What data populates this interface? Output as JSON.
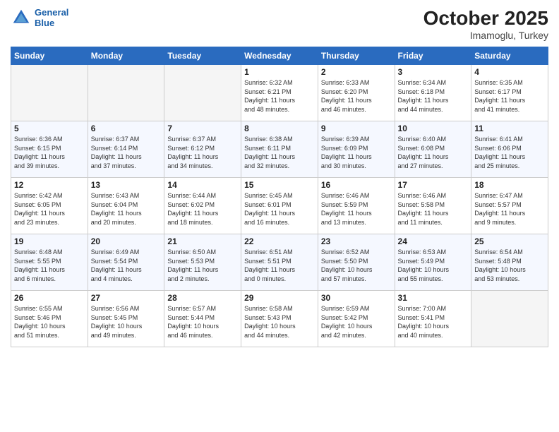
{
  "header": {
    "logo_line1": "General",
    "logo_line2": "Blue",
    "month": "October 2025",
    "location": "Imamoglu, Turkey"
  },
  "days_of_week": [
    "Sunday",
    "Monday",
    "Tuesday",
    "Wednesday",
    "Thursday",
    "Friday",
    "Saturday"
  ],
  "weeks": [
    [
      {
        "day": "",
        "info": ""
      },
      {
        "day": "",
        "info": ""
      },
      {
        "day": "",
        "info": ""
      },
      {
        "day": "1",
        "info": "Sunrise: 6:32 AM\nSunset: 6:21 PM\nDaylight: 11 hours\nand 48 minutes."
      },
      {
        "day": "2",
        "info": "Sunrise: 6:33 AM\nSunset: 6:20 PM\nDaylight: 11 hours\nand 46 minutes."
      },
      {
        "day": "3",
        "info": "Sunrise: 6:34 AM\nSunset: 6:18 PM\nDaylight: 11 hours\nand 44 minutes."
      },
      {
        "day": "4",
        "info": "Sunrise: 6:35 AM\nSunset: 6:17 PM\nDaylight: 11 hours\nand 41 minutes."
      }
    ],
    [
      {
        "day": "5",
        "info": "Sunrise: 6:36 AM\nSunset: 6:15 PM\nDaylight: 11 hours\nand 39 minutes."
      },
      {
        "day": "6",
        "info": "Sunrise: 6:37 AM\nSunset: 6:14 PM\nDaylight: 11 hours\nand 37 minutes."
      },
      {
        "day": "7",
        "info": "Sunrise: 6:37 AM\nSunset: 6:12 PM\nDaylight: 11 hours\nand 34 minutes."
      },
      {
        "day": "8",
        "info": "Sunrise: 6:38 AM\nSunset: 6:11 PM\nDaylight: 11 hours\nand 32 minutes."
      },
      {
        "day": "9",
        "info": "Sunrise: 6:39 AM\nSunset: 6:09 PM\nDaylight: 11 hours\nand 30 minutes."
      },
      {
        "day": "10",
        "info": "Sunrise: 6:40 AM\nSunset: 6:08 PM\nDaylight: 11 hours\nand 27 minutes."
      },
      {
        "day": "11",
        "info": "Sunrise: 6:41 AM\nSunset: 6:06 PM\nDaylight: 11 hours\nand 25 minutes."
      }
    ],
    [
      {
        "day": "12",
        "info": "Sunrise: 6:42 AM\nSunset: 6:05 PM\nDaylight: 11 hours\nand 23 minutes."
      },
      {
        "day": "13",
        "info": "Sunrise: 6:43 AM\nSunset: 6:04 PM\nDaylight: 11 hours\nand 20 minutes."
      },
      {
        "day": "14",
        "info": "Sunrise: 6:44 AM\nSunset: 6:02 PM\nDaylight: 11 hours\nand 18 minutes."
      },
      {
        "day": "15",
        "info": "Sunrise: 6:45 AM\nSunset: 6:01 PM\nDaylight: 11 hours\nand 16 minutes."
      },
      {
        "day": "16",
        "info": "Sunrise: 6:46 AM\nSunset: 5:59 PM\nDaylight: 11 hours\nand 13 minutes."
      },
      {
        "day": "17",
        "info": "Sunrise: 6:46 AM\nSunset: 5:58 PM\nDaylight: 11 hours\nand 11 minutes."
      },
      {
        "day": "18",
        "info": "Sunrise: 6:47 AM\nSunset: 5:57 PM\nDaylight: 11 hours\nand 9 minutes."
      }
    ],
    [
      {
        "day": "19",
        "info": "Sunrise: 6:48 AM\nSunset: 5:55 PM\nDaylight: 11 hours\nand 6 minutes."
      },
      {
        "day": "20",
        "info": "Sunrise: 6:49 AM\nSunset: 5:54 PM\nDaylight: 11 hours\nand 4 minutes."
      },
      {
        "day": "21",
        "info": "Sunrise: 6:50 AM\nSunset: 5:53 PM\nDaylight: 11 hours\nand 2 minutes."
      },
      {
        "day": "22",
        "info": "Sunrise: 6:51 AM\nSunset: 5:51 PM\nDaylight: 11 hours\nand 0 minutes."
      },
      {
        "day": "23",
        "info": "Sunrise: 6:52 AM\nSunset: 5:50 PM\nDaylight: 10 hours\nand 57 minutes."
      },
      {
        "day": "24",
        "info": "Sunrise: 6:53 AM\nSunset: 5:49 PM\nDaylight: 10 hours\nand 55 minutes."
      },
      {
        "day": "25",
        "info": "Sunrise: 6:54 AM\nSunset: 5:48 PM\nDaylight: 10 hours\nand 53 minutes."
      }
    ],
    [
      {
        "day": "26",
        "info": "Sunrise: 6:55 AM\nSunset: 5:46 PM\nDaylight: 10 hours\nand 51 minutes."
      },
      {
        "day": "27",
        "info": "Sunrise: 6:56 AM\nSunset: 5:45 PM\nDaylight: 10 hours\nand 49 minutes."
      },
      {
        "day": "28",
        "info": "Sunrise: 6:57 AM\nSunset: 5:44 PM\nDaylight: 10 hours\nand 46 minutes."
      },
      {
        "day": "29",
        "info": "Sunrise: 6:58 AM\nSunset: 5:43 PM\nDaylight: 10 hours\nand 44 minutes."
      },
      {
        "day": "30",
        "info": "Sunrise: 6:59 AM\nSunset: 5:42 PM\nDaylight: 10 hours\nand 42 minutes."
      },
      {
        "day": "31",
        "info": "Sunrise: 7:00 AM\nSunset: 5:41 PM\nDaylight: 10 hours\nand 40 minutes."
      },
      {
        "day": "",
        "info": ""
      }
    ]
  ]
}
